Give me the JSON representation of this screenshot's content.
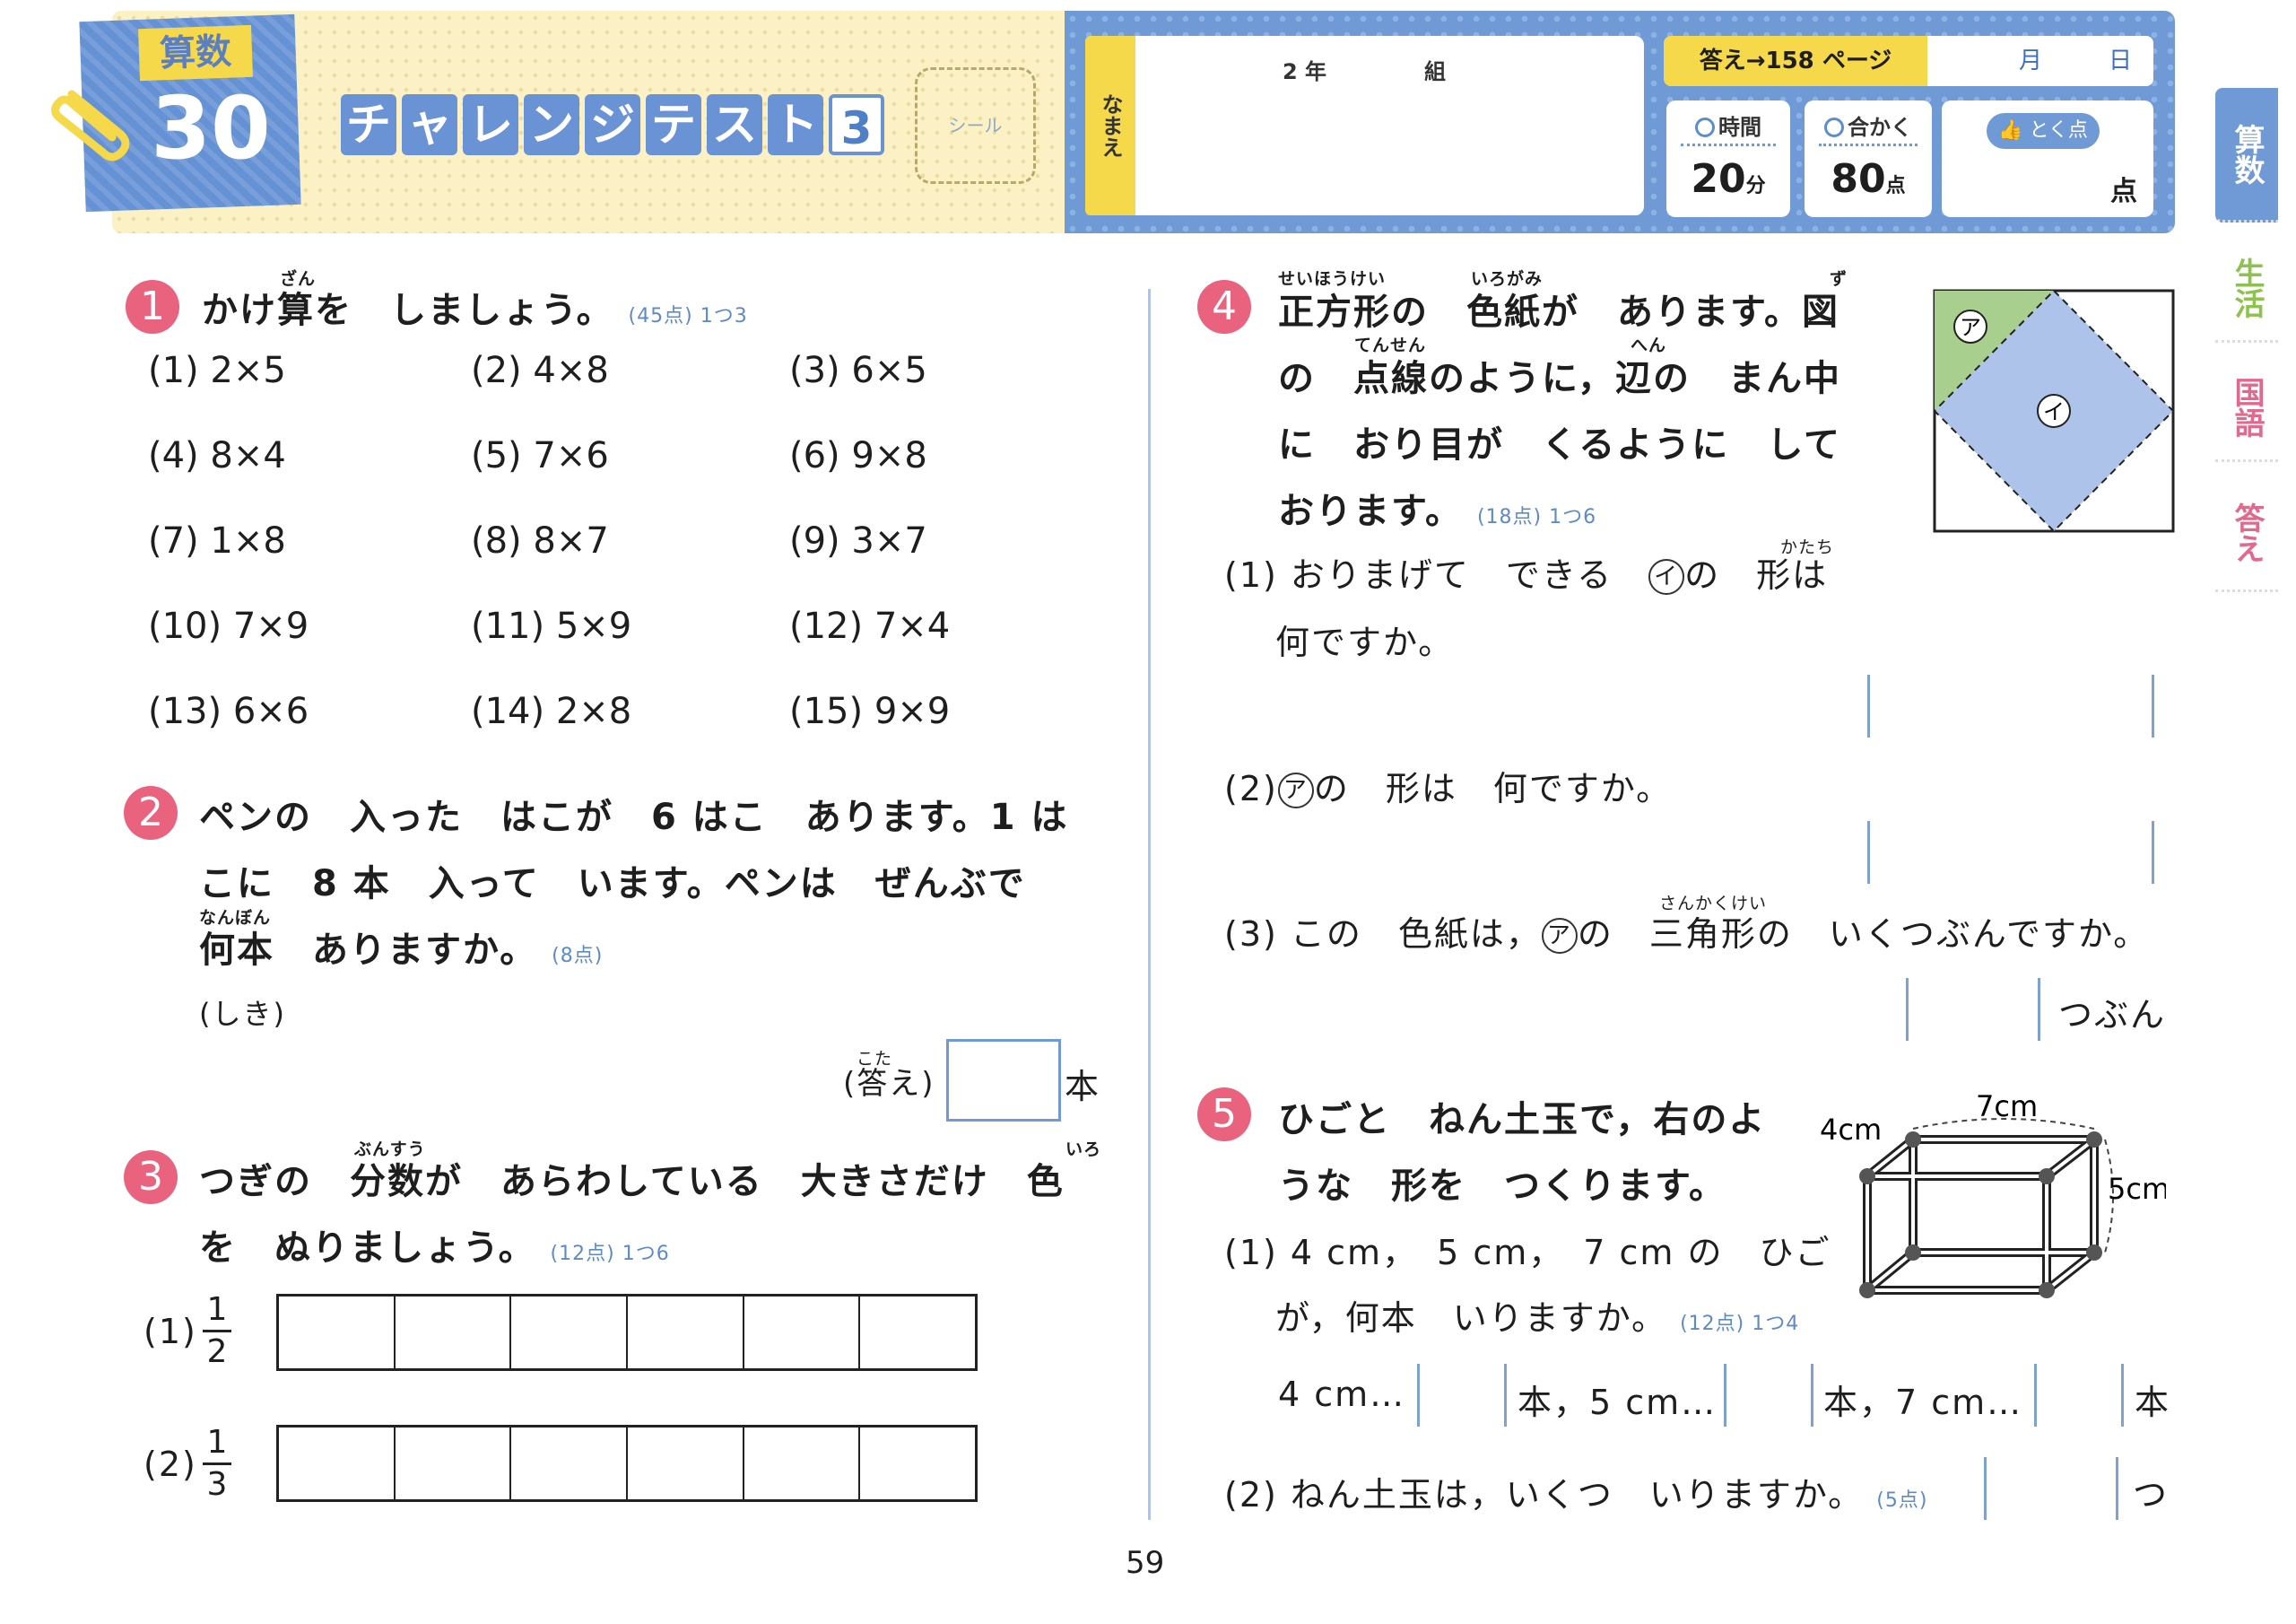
{
  "header": {
    "subject": "算数",
    "lesson_number": "30",
    "title_chars": [
      "チ",
      "ャ",
      "レ",
      "ン",
      "ジ",
      "テ",
      "ス",
      "ト"
    ],
    "title_number": "3",
    "sticker": "シール",
    "name_label": "なまえ",
    "grade": "2 年",
    "class": "組",
    "answer_ref": "答え→158 ページ",
    "date_month": "月",
    "date_day": "日",
    "time_label": "時間",
    "time_value": "20",
    "time_unit": "分",
    "pass_label": "合かく",
    "pass_value": "80",
    "pass_unit": "点",
    "score_label": "とく点",
    "score_unit": "点"
  },
  "side_tabs": [
    "算数",
    "生活",
    "国語",
    "答え"
  ],
  "q1": {
    "num": "1",
    "text": "かけ算を　しましょう。",
    "ruby": "ざん",
    "points": "(45点) 1つ3",
    "problems": [
      "(1) 2×5",
      "(2) 4×8",
      "(3) 6×5",
      "(4) 8×4",
      "(5) 7×6",
      "(6) 9×8",
      "(7) 1×8",
      "(8) 8×7",
      "(9) 3×7",
      "(10) 7×9",
      "(11) 5×9",
      "(12) 7×4",
      "(13) 6×6",
      "(14) 2×8",
      "(15) 9×9"
    ]
  },
  "q2": {
    "num": "2",
    "line1": "ペンの　入った　はこが　6 はこ　あります。1 は",
    "line2": "こに　8 本　入って　います。ペンは　ぜんぶで",
    "line3": "何本　ありますか。",
    "ruby": "なんぼん",
    "points": "(8点)",
    "formula_label": "(しき)",
    "answer_label": "(答え)",
    "answer_ruby": "こた",
    "answer_unit": "本"
  },
  "q3": {
    "num": "3",
    "line1": "つぎの　分数が　あらわしている　大きさだけ　色",
    "ruby1": "ぶんすう",
    "ruby2": "いろ",
    "line2": "を　ぬりましょう。",
    "points": "(12点) 1つ6",
    "p1_label": "(1)",
    "p1_num": "1",
    "p1_den": "2",
    "p2_label": "(2)",
    "p2_num": "1",
    "p2_den": "3"
  },
  "q4": {
    "num": "4",
    "line1": "正方形の　色紙が　あります。図",
    "ruby1": "せいほうけい",
    "ruby2": "いろがみ",
    "ruby3": "ず",
    "line2": "の　点線のように，辺の　まん中",
    "ruby4": "てんせん",
    "ruby5": "へん",
    "line3": "に　おり目が　くるように　して",
    "line4": "おります。",
    "points": "(18点) 1つ6",
    "p1_a": "(1) おりまげて　できる",
    "p1_b": "の　形は",
    "ruby6": "かたち",
    "p1_c": "何ですか。",
    "p2_a": "(2)",
    "p2_b": "の　形は　何ですか。",
    "p3_a": "(3) この　色紙は，",
    "p3_b": "の　三角形の　いくつぶんですか。",
    "ruby7": "さんかくけい",
    "p3_unit": "つぶん",
    "mark_a": "ア",
    "mark_i": "イ"
  },
  "q5": {
    "num": "5",
    "line1": "ひごと　ねん土玉で，右のよ",
    "line2": "うな　形を　つくります。",
    "p1_a": "(1) 4 cm，　5 cm，　7 cm の　ひご",
    "p1_b": "が，何本　いりますか。",
    "points1": "(12点) 1つ4",
    "p1_ans1": "4 cm…",
    "p1_ans2": "本，5 cm…",
    "p1_ans3": "本，7 cm…",
    "p1_ans4": "本",
    "p2": "(2) ねん土玉は，いくつ　いりますか。",
    "points2": "(5点)",
    "p2_unit": "つ",
    "dim_7": "7cm",
    "dim_4": "4cm",
    "dim_5": "5cm"
  },
  "page_number": "59"
}
